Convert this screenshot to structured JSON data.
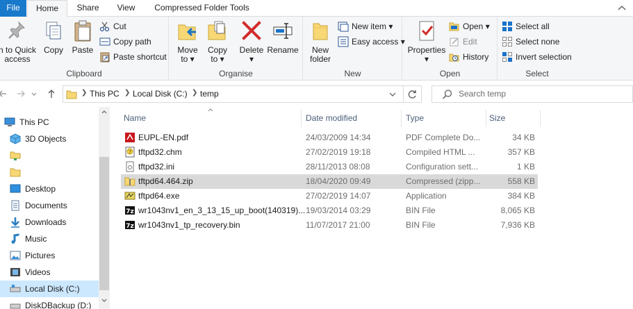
{
  "tabs": {
    "file": "File",
    "home": "Home",
    "share": "Share",
    "view": "View",
    "compressed": "Compressed Folder Tools"
  },
  "ribbon": {
    "clipboard": {
      "label": "Clipboard",
      "pin": "n to Quick access",
      "pin_line1": "n to Quick",
      "pin_line2": "access",
      "copy": "Copy",
      "paste": "Paste",
      "cut": "Cut",
      "copy_path": "Copy path",
      "paste_shortcut": "Paste shortcut"
    },
    "organise": {
      "label": "Organise",
      "move_to": "Move",
      "move_to_2": "to",
      "copy_to": "Copy",
      "copy_to_2": "to",
      "delete": "Delete",
      "rename": "Rename"
    },
    "new": {
      "label": "New",
      "new_folder_1": "New",
      "new_folder_2": "folder",
      "new_item": "New item",
      "easy_access": "Easy access"
    },
    "open": {
      "label": "Open",
      "properties": "Properties",
      "open": "Open",
      "edit": "Edit",
      "history": "History"
    },
    "select": {
      "label": "Select",
      "select_all": "Select all",
      "select_none": "Select none",
      "invert": "Invert selection"
    }
  },
  "address": {
    "crumbs": [
      "This PC",
      "Local Disk (C:)",
      "temp"
    ],
    "search_placeholder": "Search temp"
  },
  "sidebar": {
    "items": [
      {
        "label": "This PC",
        "icon": "pc-icon"
      },
      {
        "label": "3D Objects",
        "icon": "3d-objects-icon"
      },
      {
        "label": "",
        "icon": "network-folder-icon"
      },
      {
        "label": "",
        "icon": "folder-icon"
      },
      {
        "label": "Desktop",
        "icon": "desktop-icon"
      },
      {
        "label": "Documents",
        "icon": "documents-icon"
      },
      {
        "label": "Downloads",
        "icon": "downloads-icon"
      },
      {
        "label": "Music",
        "icon": "music-icon"
      },
      {
        "label": "Pictures",
        "icon": "pictures-icon"
      },
      {
        "label": "Videos",
        "icon": "videos-icon"
      },
      {
        "label": "Local Disk (C:)",
        "icon": "drive-icon"
      },
      {
        "label": "DiskDBackup (D:)",
        "icon": "drive-icon"
      }
    ]
  },
  "columns": {
    "name": "Name",
    "date": "Date modified",
    "type": "Type",
    "size": "Size"
  },
  "files": [
    {
      "name": "EUPL-EN.pdf",
      "date": "24/03/2009 14:34",
      "type": "PDF Complete Do...",
      "size": "34 KB",
      "icon": "pdf-icon"
    },
    {
      "name": "tftpd32.chm",
      "date": "27/02/2019 19:18",
      "type": "Compiled HTML ...",
      "size": "357 KB",
      "icon": "chm-icon"
    },
    {
      "name": "tftpd32.ini",
      "date": "28/11/2013 08:08",
      "type": "Configuration sett...",
      "size": "1 KB",
      "icon": "ini-icon"
    },
    {
      "name": "tftpd64.464.zip",
      "date": "18/04/2020 09:49",
      "type": "Compressed (zipp...",
      "size": "558 KB",
      "icon": "zip-icon",
      "selected": true
    },
    {
      "name": "tftpd64.exe",
      "date": "27/02/2019 14:07",
      "type": "Application",
      "size": "384 KB",
      "icon": "exe-icon"
    },
    {
      "name": "wr1043nv1_en_3_13_15_up_boot(140319)....",
      "date": "19/03/2014 03:29",
      "type": "BIN File",
      "size": "8,065 KB",
      "icon": "7z-icon"
    },
    {
      "name": "wr1043nv1_tp_recovery.bin",
      "date": "11/07/2017 21:00",
      "type": "BIN File",
      "size": "7,936 KB",
      "icon": "7z-icon"
    }
  ],
  "colors": {
    "accent": "#1979ca",
    "selected_row": "#d9d9d9",
    "ribbon_bg": "#f5f6f7"
  }
}
